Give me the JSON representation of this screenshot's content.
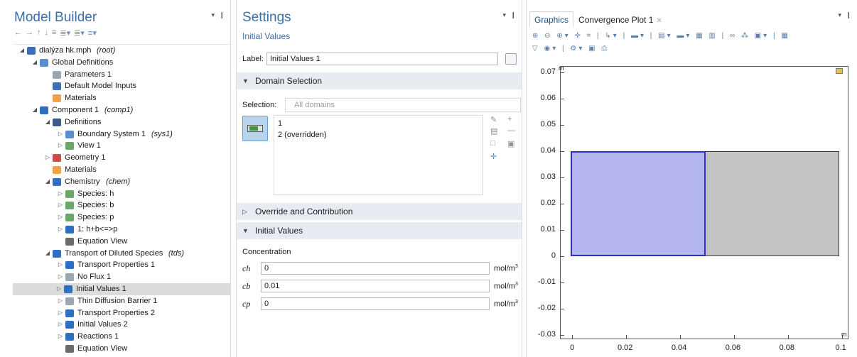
{
  "model_builder": {
    "title": "Model Builder",
    "pin": "▾ ❙",
    "toolbar": [
      "←",
      "→",
      "↑",
      "↓",
      "≡",
      "≣▾",
      "≣▾",
      "≡▾"
    ],
    "tree": [
      {
        "label": "dialýza hk.mph",
        "tag": "(root)",
        "level": 0,
        "twisty": "◢",
        "icon": "model-icon",
        "color": "#3a6fb6"
      },
      {
        "label": "Global Definitions",
        "tag": "",
        "level": 1,
        "twisty": "◢",
        "icon": "globe-icon",
        "color": "#5a8fcf"
      },
      {
        "label": "Parameters 1",
        "tag": "",
        "level": 2,
        "twisty": "",
        "icon": "parameters-icon",
        "color": "#9aa7b5"
      },
      {
        "label": "Default Model Inputs",
        "tag": "",
        "level": 2,
        "twisty": "",
        "icon": "model-inputs-icon",
        "color": "#3a6fb6"
      },
      {
        "label": "Materials",
        "tag": "",
        "level": 2,
        "twisty": "",
        "icon": "materials-icon",
        "color": "#f0a24a"
      },
      {
        "label": "Component 1",
        "tag": "(comp1)",
        "level": 1,
        "twisty": "◢",
        "icon": "component-icon",
        "color": "#2f6fc2"
      },
      {
        "label": "Definitions",
        "tag": "",
        "level": 2,
        "twisty": "◢",
        "icon": "definitions-icon",
        "color": "#3a5a8a"
      },
      {
        "label": "Boundary System 1",
        "tag": "(sys1)",
        "level": 3,
        "twisty": "▷",
        "icon": "boundary-system-icon",
        "color": "#5a8fcf"
      },
      {
        "label": "View 1",
        "tag": "",
        "level": 3,
        "twisty": "▷",
        "icon": "view-icon",
        "color": "#6aa86a"
      },
      {
        "label": "Geometry 1",
        "tag": "",
        "level": 2,
        "twisty": "▷",
        "icon": "geometry-icon",
        "color": "#d04a4a"
      },
      {
        "label": "Materials",
        "tag": "",
        "level": 2,
        "twisty": "",
        "icon": "materials-icon",
        "color": "#f0a24a"
      },
      {
        "label": "Chemistry",
        "tag": "(chem)",
        "level": 2,
        "twisty": "◢",
        "icon": "chemistry-icon",
        "color": "#2f6fc2"
      },
      {
        "label": "Species: h",
        "tag": "",
        "level": 3,
        "twisty": "▷",
        "icon": "species-icon",
        "color": "#6aa86a"
      },
      {
        "label": "Species: b",
        "tag": "",
        "level": 3,
        "twisty": "▷",
        "icon": "species-icon",
        "color": "#6aa86a"
      },
      {
        "label": "Species: p",
        "tag": "",
        "level": 3,
        "twisty": "▷",
        "icon": "species-icon",
        "color": "#6aa86a"
      },
      {
        "label": "1: h+b<=>p",
        "tag": "",
        "level": 3,
        "twisty": "▷",
        "icon": "reaction-icon",
        "color": "#2f6fc2"
      },
      {
        "label": "Equation View",
        "tag": "",
        "level": 3,
        "twisty": "",
        "icon": "equation-view-icon",
        "color": "#6b6b6b"
      },
      {
        "label": "Transport of Diluted Species",
        "tag": "(tds)",
        "level": 2,
        "twisty": "◢",
        "icon": "transport-icon",
        "color": "#2f6fc2"
      },
      {
        "label": "Transport Properties 1",
        "tag": "",
        "level": 3,
        "twisty": "▷",
        "icon": "transport-properties-icon",
        "color": "#2f6fc2"
      },
      {
        "label": "No Flux 1",
        "tag": "",
        "level": 3,
        "twisty": "▷",
        "icon": "no-flux-icon",
        "color": "#9aa7b5"
      },
      {
        "label": "Initial Values 1",
        "tag": "",
        "level": 3,
        "twisty": "▷",
        "icon": "initial-values-icon",
        "color": "#2f6fc2",
        "selected": true
      },
      {
        "label": "Thin Diffusion Barrier 1",
        "tag": "",
        "level": 3,
        "twisty": "▷",
        "icon": "thin-barrier-icon",
        "color": "#9aa7b5"
      },
      {
        "label": "Transport Properties 2",
        "tag": "",
        "level": 3,
        "twisty": "▷",
        "icon": "transport-properties-icon",
        "color": "#2f6fc2"
      },
      {
        "label": "Initial Values 2",
        "tag": "",
        "level": 3,
        "twisty": "▷",
        "icon": "initial-values-icon",
        "color": "#2f6fc2"
      },
      {
        "label": "Reactions 1",
        "tag": "",
        "level": 3,
        "twisty": "▷",
        "icon": "reactions-icon",
        "color": "#2f6fc2"
      },
      {
        "label": "Equation View",
        "tag": "",
        "level": 3,
        "twisty": "",
        "icon": "equation-view-icon",
        "color": "#6b6b6b"
      }
    ]
  },
  "settings": {
    "title": "Settings",
    "pin": "▾ ❙",
    "subtitle": "Initial Values",
    "label_caption": "Label:",
    "label_value": "Initial Values 1",
    "sections": {
      "domain_selection": "Domain Selection",
      "override": "Override and Contribution",
      "initial_values": "Initial Values"
    },
    "selection_caption": "Selection:",
    "selection_value": "All domains",
    "domains": [
      "1",
      "2 (overridden)"
    ],
    "concentration_caption": "Concentration",
    "variables": [
      {
        "name": "ch",
        "value": "0",
        "unit": "mol/m",
        "exp": "3"
      },
      {
        "name": "cb",
        "value": "0.01",
        "unit": "mol/m",
        "exp": "3"
      },
      {
        "name": "cp",
        "value": "0",
        "unit": "mol/m",
        "exp": "3"
      }
    ]
  },
  "graphics": {
    "tabs": [
      {
        "label": "Graphics",
        "active": true
      },
      {
        "label": "Convergence Plot 1",
        "active": false
      }
    ],
    "pin": "▾ ❙",
    "toolbar_row1": "⊕ ⊖ ⊕▾ ✛ ⌗ | ↳▾ | ▬▾ | ▤▾ ▬▾ ▦ ▥ | ∞ ⁂ ▣▾ | ▦",
    "toolbar_row2": "▽ ◉▾ | ⚙▾ ▣ ⎙",
    "axis_unit": "m",
    "y_ticks": [
      "0.07",
      "0.06",
      "0.05",
      "0.04",
      "0.03",
      "0.02",
      "0.01",
      "0",
      "-0.01",
      "-0.02",
      "-0.03"
    ],
    "x_ticks": [
      "0",
      "0.02",
      "0.04",
      "0.06",
      "0.08",
      "0.1"
    ],
    "colors": {
      "selected_domain": "#b4b4ef",
      "selected_border": "#2e2ec8",
      "other_domain": "#c4c4c4"
    }
  }
}
